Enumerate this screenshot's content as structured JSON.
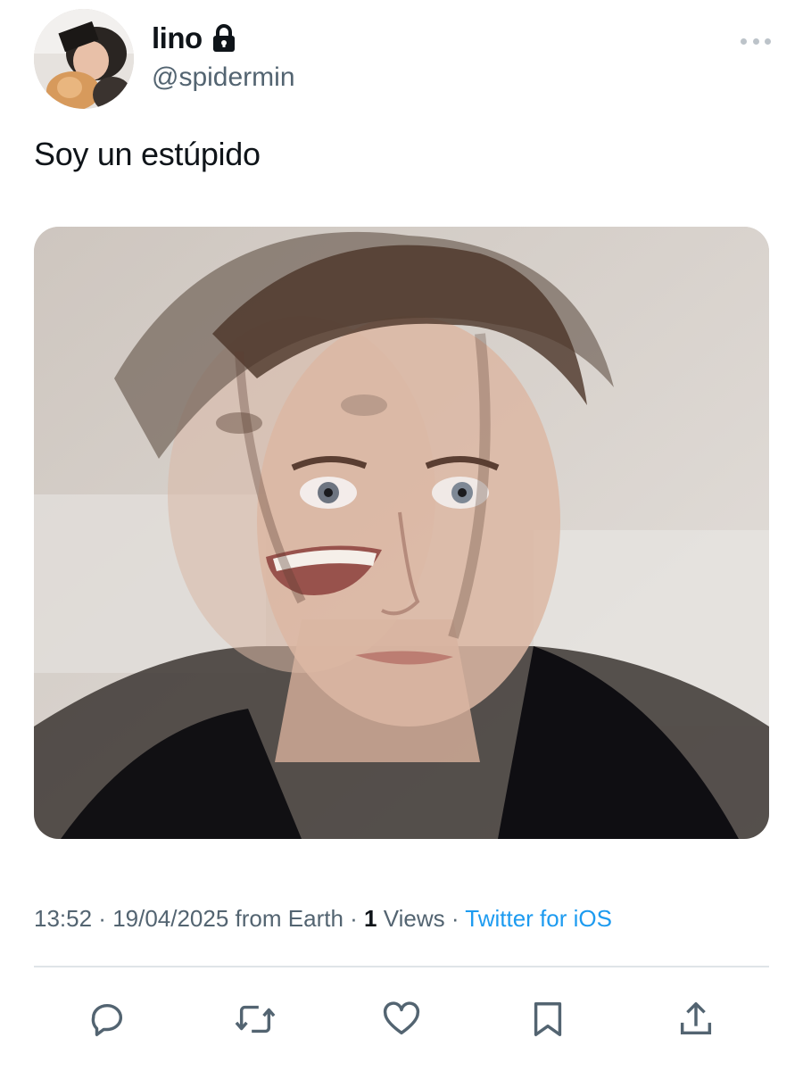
{
  "author": {
    "display_name": "lino",
    "handle": "@spidermin",
    "protected": true
  },
  "tweet": {
    "text": "Soy un estúpido"
  },
  "meta": {
    "time": "13:52",
    "sep1": " · ",
    "date": "19/04/2025",
    "location": " from Earth",
    "sep2": " · ",
    "views_count": "1",
    "views_label": " Views",
    "sep3": " · ",
    "source": "Twitter for iOS"
  },
  "actions": {
    "icons": [
      "reply-icon",
      "retweet-icon",
      "like-icon",
      "bookmark-icon",
      "share-icon"
    ]
  },
  "colors": {
    "text_primary": "#0f1419",
    "text_secondary": "#536471",
    "link": "#1d9bf0",
    "divider": "#dfe4e8"
  }
}
